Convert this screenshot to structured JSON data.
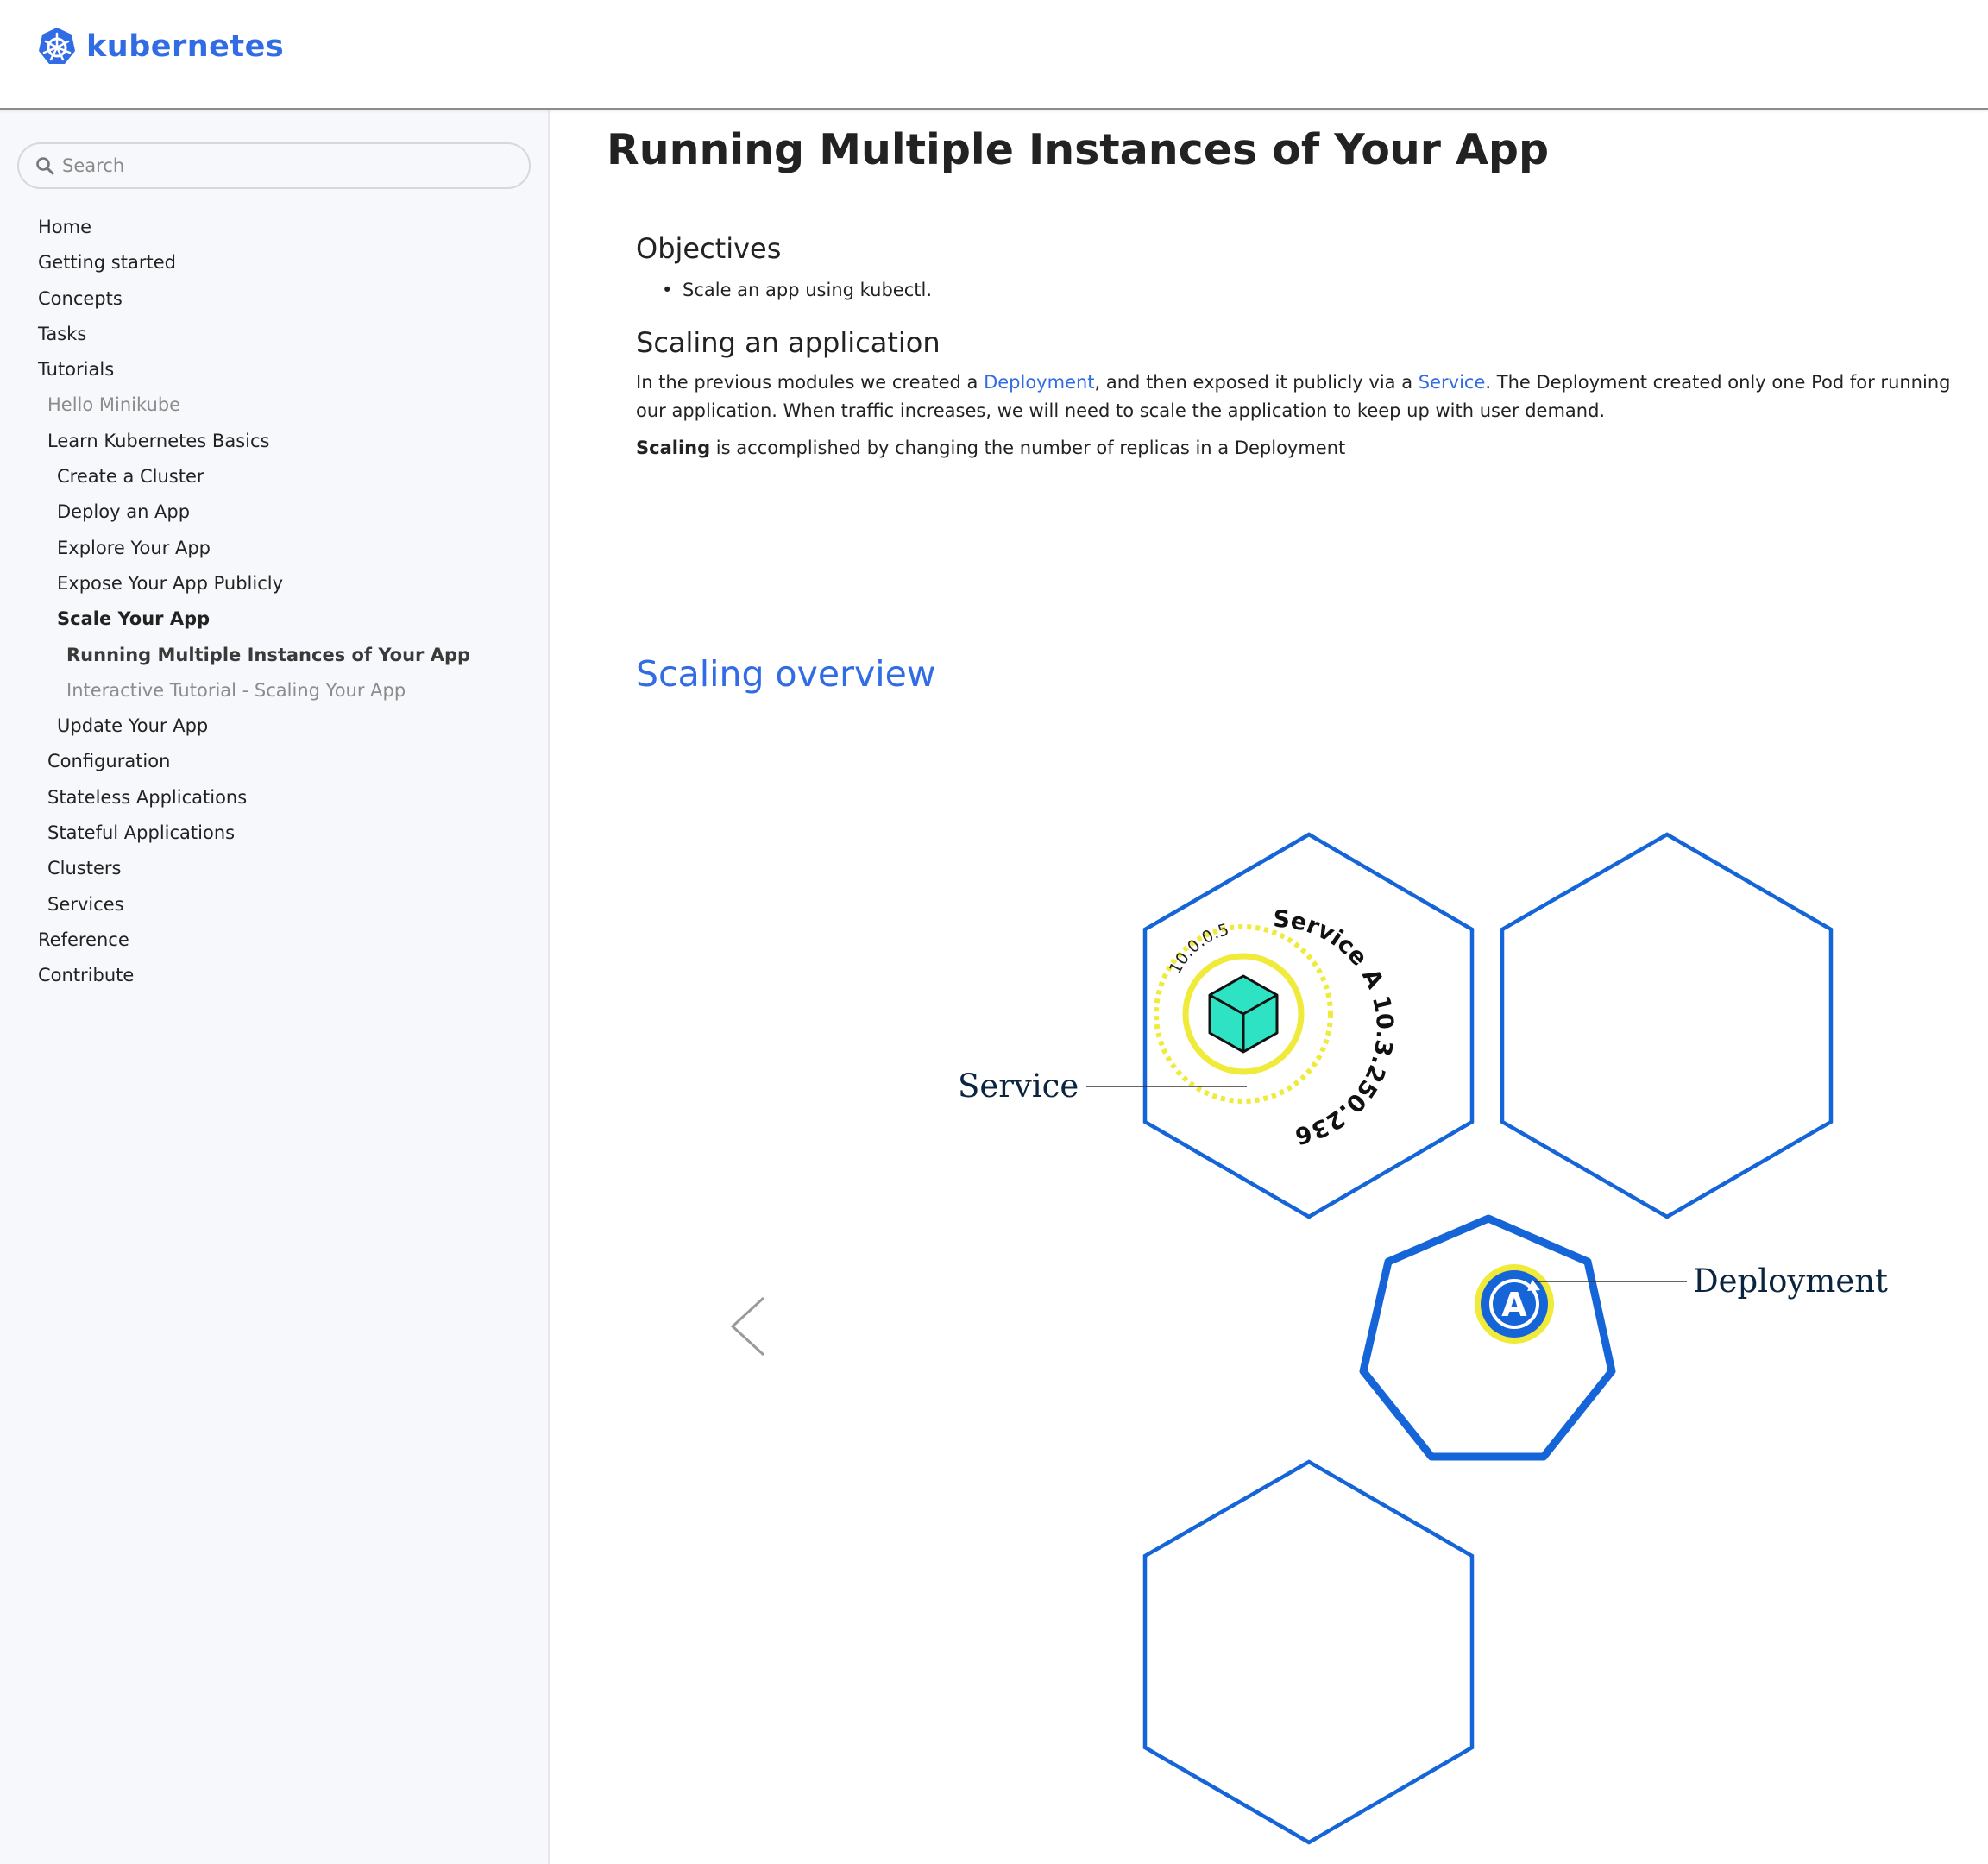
{
  "header": {
    "logo_text": "kubernetes",
    "logo_icon": "kubernetes-helm-icon",
    "brand_color": "#326ce5"
  },
  "sidebar": {
    "search": {
      "placeholder": "Search",
      "value": ""
    },
    "items": [
      {
        "label": "Home",
        "level": 0
      },
      {
        "label": "Getting started",
        "level": 0
      },
      {
        "label": "Concepts",
        "level": 0
      },
      {
        "label": "Tasks",
        "level": 0
      },
      {
        "label": "Tutorials",
        "level": 0
      },
      {
        "label": "Hello Minikube",
        "level": 1,
        "style": "muted"
      },
      {
        "label": "Learn Kubernetes Basics",
        "level": 1
      },
      {
        "label": "Create a Cluster",
        "level": 2
      },
      {
        "label": "Deploy an App",
        "level": 2
      },
      {
        "label": "Explore Your App",
        "level": 2
      },
      {
        "label": "Expose Your App Publicly",
        "level": 2
      },
      {
        "label": "Scale Your App",
        "level": 2,
        "style": "bold"
      },
      {
        "label": "Running Multiple Instances of Your App",
        "level": 3,
        "style": "bold-dark"
      },
      {
        "label": "Interactive Tutorial - Scaling Your App",
        "level": 3,
        "style": "muted"
      },
      {
        "label": "Update Your App",
        "level": 2
      },
      {
        "label": "Configuration",
        "level": 1
      },
      {
        "label": "Stateless Applications",
        "level": 1
      },
      {
        "label": "Stateful Applications",
        "level": 1
      },
      {
        "label": "Clusters",
        "level": 1
      },
      {
        "label": "Services",
        "level": 1
      },
      {
        "label": "Reference",
        "level": 0
      },
      {
        "label": "Contribute",
        "level": 0
      }
    ]
  },
  "main": {
    "title": "Running Multiple Instances of Your App",
    "objectives_heading": "Objectives",
    "objectives": [
      "Scale an app using kubectl."
    ],
    "scaling_heading": "Scaling an application",
    "para1": {
      "t1": "In the previous modules we created a ",
      "link1": "Deployment",
      "t2": ", and then exposed it publicly via a ",
      "link2": "Service",
      "t3": ". The Deployment created only one Pod for running our application. When traffic increases, we will need to scale the application to keep up with user demand."
    },
    "para2": {
      "bold": "Scaling",
      "rest": " is accomplished by changing the number of replicas in a Deployment"
    },
    "overview_heading": "Scaling overview",
    "diagram": {
      "service_label": "Service",
      "deployment_label": "Deployment",
      "service_name_ip": "Service A 10.3.250.236",
      "pod_ip": "10.0.0.5",
      "deployment_badge_letter": "A",
      "prev_icon": "chevron-left-icon",
      "colors": {
        "hex_stroke": "#1565d8",
        "yellow": "#f0ea3a",
        "pod_cube": "#2de3c3",
        "badge_blue": "#1565d8"
      }
    }
  }
}
